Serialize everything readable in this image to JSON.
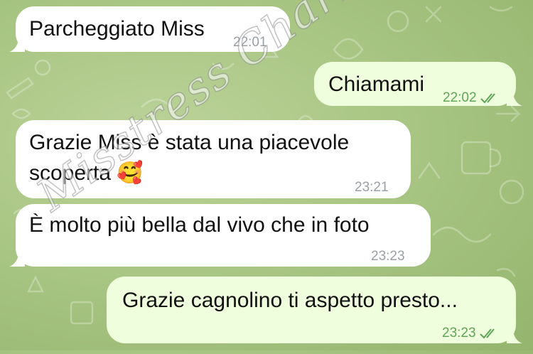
{
  "messages": [
    {
      "direction": "incoming",
      "lines": [
        "Parcheggiato Miss"
      ],
      "time": "22:01"
    },
    {
      "direction": "outgoing",
      "lines": [
        "Chiamami"
      ],
      "time": "22:02",
      "status": "read"
    },
    {
      "direction": "incoming",
      "lines": [
        "Grazie Miss è stata una piacevole",
        "scoperta 🥰"
      ],
      "time": "23:21"
    },
    {
      "direction": "incoming",
      "lines": [
        "È molto più bella dal vivo che in foto"
      ],
      "time": "23:23"
    },
    {
      "direction": "outgoing",
      "lines": [
        "Grazie cagnolino ti aspetto presto..."
      ],
      "time": "23:23",
      "status": "read"
    }
  ],
  "watermark": "Misstress Charlotte",
  "colors": {
    "incoming_bubble": "#ffffff",
    "outgoing_bubble": "#effedd",
    "outgoing_meta": "#5fa556",
    "incoming_meta": "#9aa0a6",
    "wallpaper": "#a9c684"
  },
  "icons": {
    "read_receipt": "double-check-icon"
  }
}
